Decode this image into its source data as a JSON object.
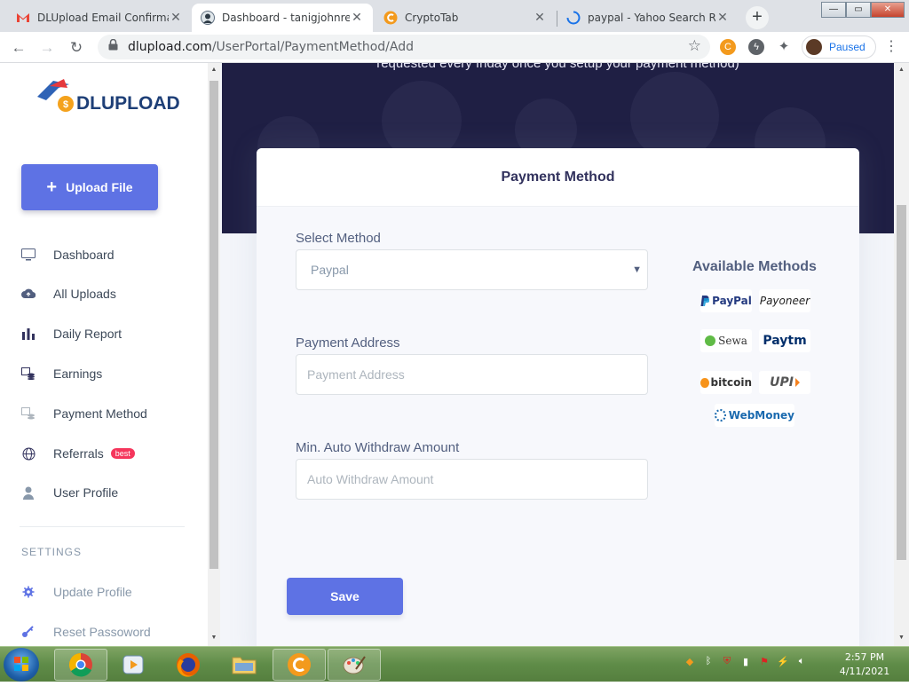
{
  "browser": {
    "tabs": [
      {
        "title": "DLUpload Email Confirmat",
        "favicon": "gmail-icon",
        "active": false
      },
      {
        "title": "Dashboard - tanigjohnrelly",
        "favicon": "avatar-icon",
        "active": true
      },
      {
        "title": "CryptoTab",
        "favicon": "cryptotab-icon",
        "active": false
      },
      {
        "title": "paypal - Yahoo Search Res",
        "favicon": "loading-icon",
        "active": false
      }
    ],
    "new_tab_label": "+",
    "window_controls": {
      "minimize": "—",
      "maximize": "▭",
      "close": "✕"
    },
    "url_host": "dlupload.com",
    "url_path": "/UserPortal/PaymentMethod/Add",
    "profile_label": "Paused"
  },
  "sidebar": {
    "logo_text": "DLUPLOAD",
    "upload_button": "Upload File",
    "items": [
      {
        "label": "Dashboard",
        "icon": "monitor-icon"
      },
      {
        "label": "All Uploads",
        "icon": "cloud-upload-icon"
      },
      {
        "label": "Daily Report",
        "icon": "bar-chart-icon"
      },
      {
        "label": "Earnings",
        "icon": "coins-icon"
      },
      {
        "label": "Payment Method",
        "icon": "wallet-icon"
      },
      {
        "label": "Referrals",
        "icon": "globe-icon",
        "badge": "best"
      },
      {
        "label": "User Profile",
        "icon": "user-icon"
      }
    ],
    "settings_heading": "SETTINGS",
    "settings_items": [
      {
        "label": "Update Profile",
        "icon": "gear-icon"
      },
      {
        "label": "Reset Passoword",
        "icon": "key-icon"
      }
    ]
  },
  "hero": {
    "text": "requested every friday once you setup your payment method)"
  },
  "card": {
    "title": "Payment Method",
    "select_label": "Select Method",
    "select_value": "Paypal",
    "address_label": "Payment Address",
    "address_placeholder": "Payment Address",
    "min_label": "Min. Auto Withdraw Amount",
    "min_placeholder": "Auto Withdraw Amount",
    "save_label": "Save",
    "available_title": "Available Methods",
    "methods": [
      "PayPal",
      "Payoneer",
      "Sewa",
      "Paytm",
      "bitcoin",
      "UPI",
      "WebMoney"
    ]
  },
  "taskbar": {
    "time": "2:57 PM",
    "date": "4/11/2021"
  },
  "colors": {
    "accent": "#5e72e4",
    "hero_bg": "#1f1f44",
    "badge": "#f5365c",
    "taskbar": "#5f8c48"
  }
}
